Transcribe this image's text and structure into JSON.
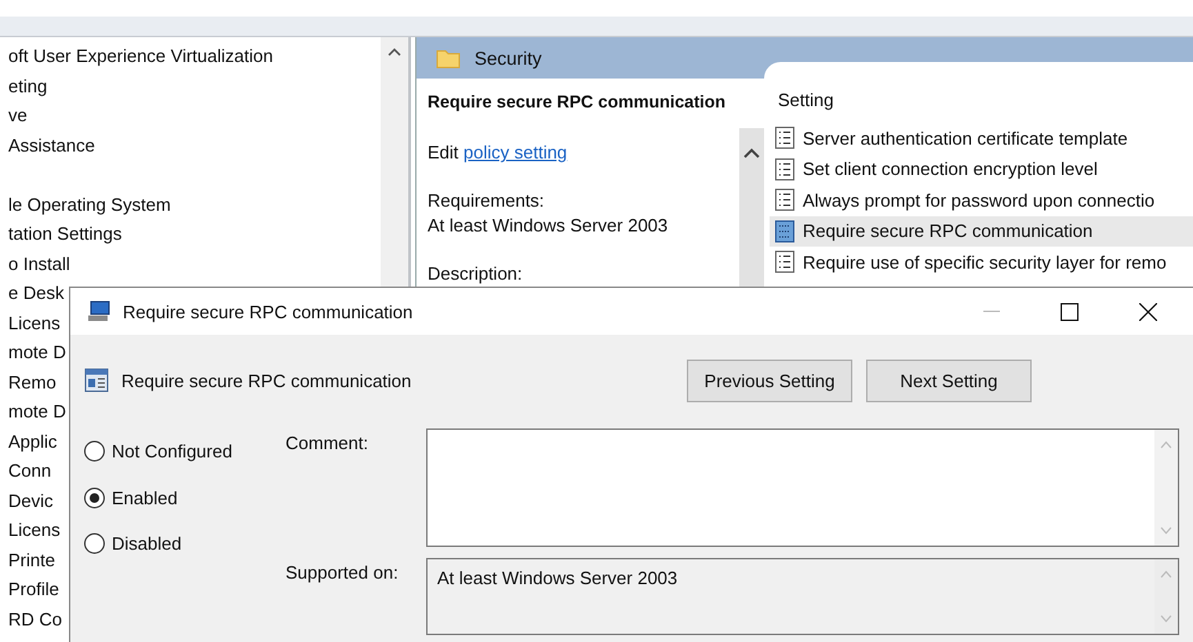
{
  "tree": {
    "groups": [
      [
        "oft User Experience Virtualization",
        "eting",
        "ve",
        "Assistance"
      ],
      [
        "le Operating System",
        "tation Settings",
        "o Install",
        "e Desk",
        "Licens",
        "mote D",
        "Remo",
        "mote D",
        "Applic",
        "Conn",
        "Devic",
        "Licens",
        "Printe",
        "Profile",
        "RD Co"
      ]
    ]
  },
  "pane": {
    "header": "Security",
    "title": "Require secure RPC communication",
    "edit_prefix": "Edit",
    "edit_link": "policy setting",
    "requirements_label": "Requirements:",
    "requirements": "At least Windows Server 2003",
    "description_label": "Description:"
  },
  "settings": {
    "column": "Setting",
    "rows": [
      {
        "label": "Server authentication certificate template",
        "selected": false
      },
      {
        "label": "Set client connection encryption level",
        "selected": false
      },
      {
        "label": "Always prompt for password upon connectio",
        "selected": false
      },
      {
        "label": "Require secure RPC communication",
        "selected": true
      },
      {
        "label": "Require use of specific security layer for remo",
        "selected": false
      }
    ]
  },
  "dialog": {
    "title": "Require secure RPC communication",
    "heading": "Require secure RPC communication",
    "buttons": [
      "Previous Setting",
      "Next Setting"
    ],
    "options": [
      {
        "label": "Not Configured",
        "selected": false
      },
      {
        "label": "Enabled",
        "selected": true
      },
      {
        "label": "Disabled",
        "selected": false
      }
    ],
    "comment_label": "Comment:",
    "supported_label": "Supported on:",
    "supported_value": "At least Windows Server 2003"
  }
}
